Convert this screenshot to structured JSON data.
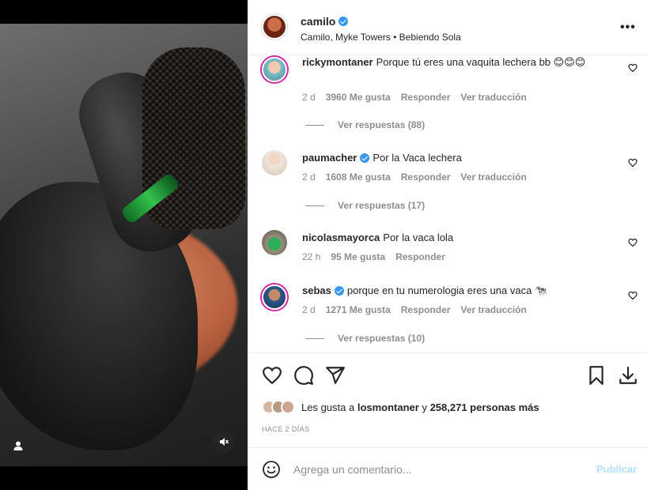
{
  "post": {
    "author": "camilo",
    "subtitle": "Camilo, Myke Towers • Bebiendo Sola",
    "more": "•••"
  },
  "comments": [
    {
      "user": "ricky montaner",
      "user_display": "rickymontaner",
      "text": "Porque tú eres una vaquita lechera bb 😊😊😊",
      "time": "2 d",
      "likes": "3960 Me gusta",
      "reply": "Responder",
      "translate": "Ver traducción",
      "replies": "Ver respuestas (88)",
      "verified": false
    },
    {
      "user_display": "paumacher",
      "text": "Por la Vaca lechera",
      "time": "2 d",
      "likes": "1608 Me gusta",
      "reply": "Responder",
      "translate": "Ver traducción",
      "replies": "Ver respuestas (17)",
      "verified": true
    },
    {
      "user_display": "nicolasmayorca",
      "text": "Por la vaca lola",
      "time": "22 h",
      "likes": "95 Me gusta",
      "reply": "Responder",
      "verified": false
    },
    {
      "user_display": "sebas",
      "text": "porque en tu numerologia eres una vaca 🐄",
      "time": "2 d",
      "likes": "1271 Me gusta",
      "reply": "Responder",
      "translate": "Ver traducción",
      "replies": "Ver respuestas (10)",
      "verified": true
    }
  ],
  "likes_summary": {
    "prefix": "Les gusta a ",
    "user": "losmontaner",
    "middle": " y ",
    "count": "258,271 personas más"
  },
  "time_ago": "HACE 2 DÍAS",
  "add_comment": {
    "placeholder": "Agrega un comentario...",
    "post_label": "Publicar"
  },
  "icons": {
    "like": "heart-icon",
    "comment": "comment-icon",
    "share": "share-icon",
    "save": "bookmark-icon",
    "download": "download-icon",
    "emoji": "emoji-icon",
    "media_user": "user-icon",
    "media_mute": "mute-icon"
  },
  "colors": {
    "verified": "#3897f0",
    "story_ring": "#d6249f",
    "post_disabled": "#b2dffc",
    "muted_text": "#8e8e8e"
  }
}
